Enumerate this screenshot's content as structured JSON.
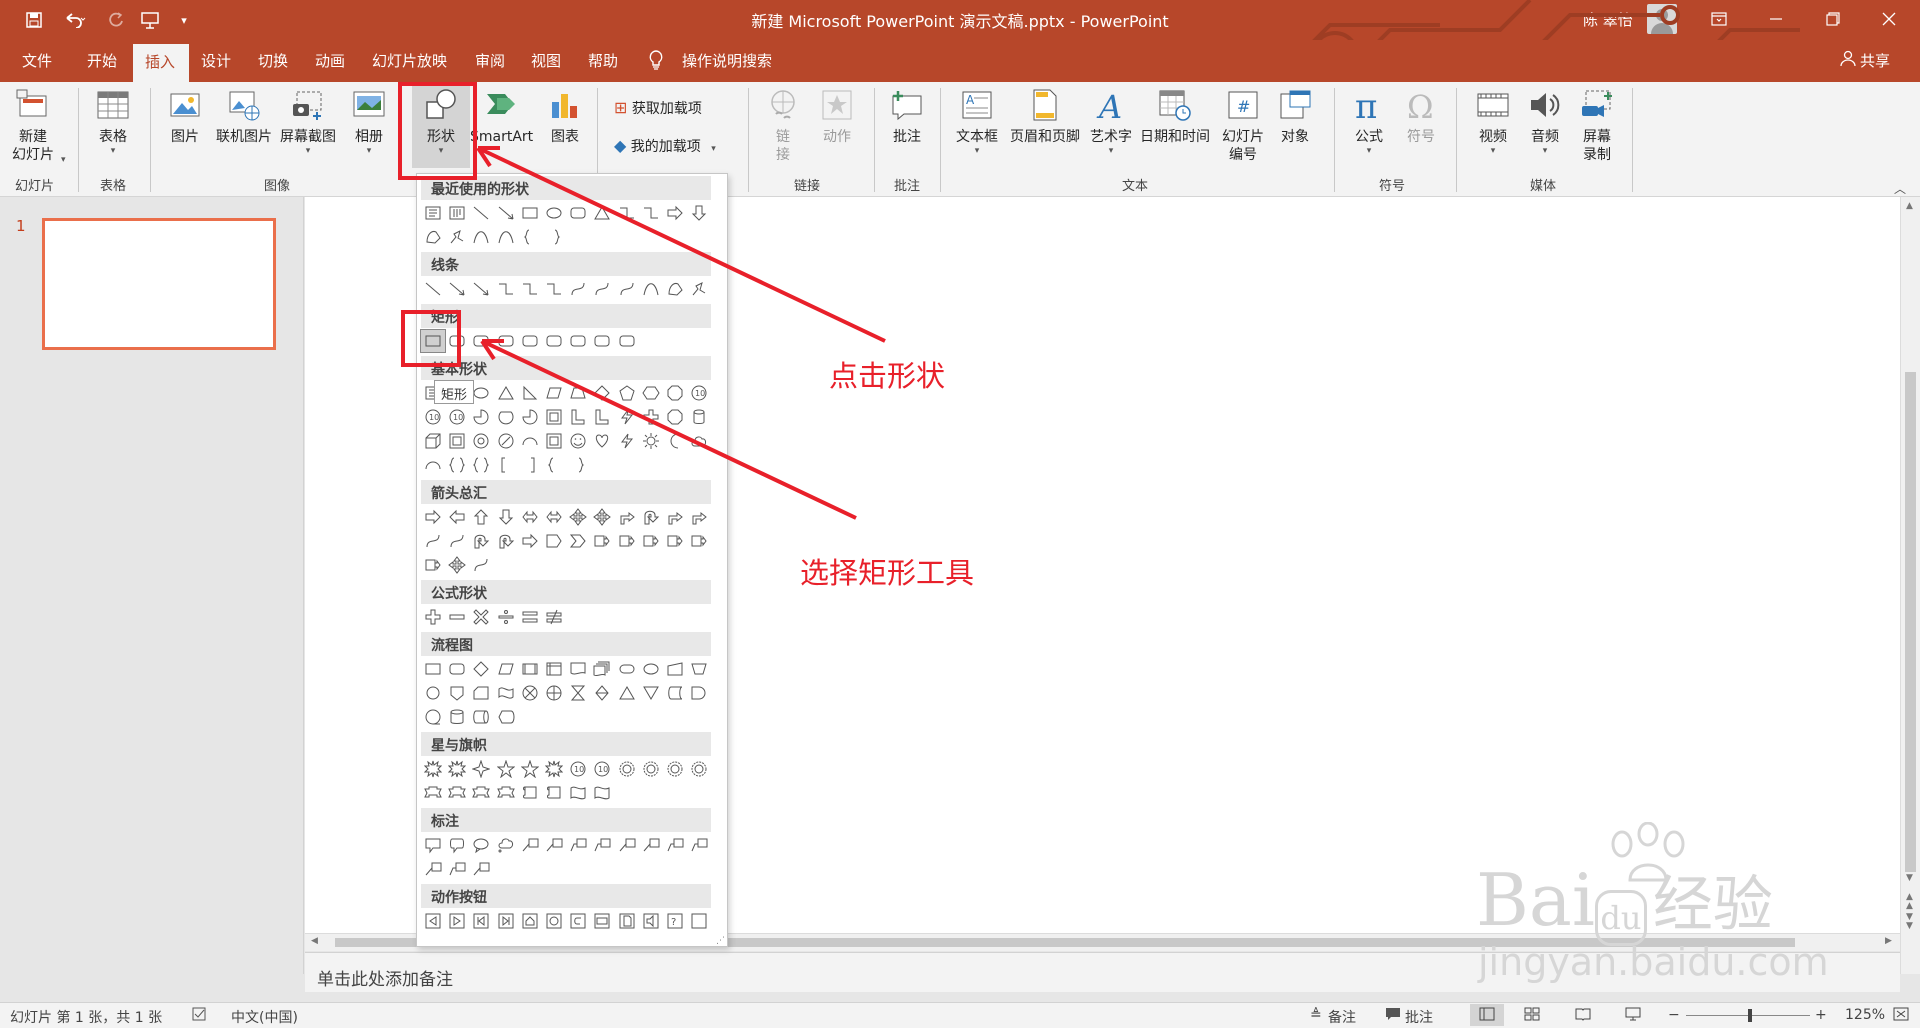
{
  "window": {
    "title": "新建 Microsoft PowerPoint 演示文稿.pptx  -  PowerPoint",
    "user": "陈 翠怡",
    "share": "共享"
  },
  "quick_access": [
    "save-icon",
    "undo-icon",
    "redo-icon",
    "present-icon",
    "customize-icon"
  ],
  "menu": {
    "items": [
      "文件",
      "开始",
      "插入",
      "设计",
      "切换",
      "动画",
      "幻灯片放映",
      "审阅",
      "视图",
      "帮助"
    ],
    "active": "插入",
    "search": "操作说明搜索"
  },
  "ribbon": {
    "buttons": {
      "new_slide": "新建\n幻灯片",
      "table": "表格",
      "picture": "图片",
      "online_picture": "联机图片",
      "screenshot": "屏幕截图",
      "album": "相册",
      "shapes": "形状",
      "smartart": "SmartArt",
      "chart": "图表",
      "get_addins": "获取加载项",
      "my_addins": "我的加载项",
      "link": "链\n接",
      "action": "动作",
      "comment": "批注",
      "textbox": "文本框",
      "header_footer": "页眉和页脚",
      "wordart": "艺术字",
      "datetime": "日期和时间",
      "slide_number": "幻灯片\n编号",
      "object": "对象",
      "equation": "公式",
      "symbol": "符号",
      "video": "视频",
      "audio": "音频",
      "screen_record": "屏幕\n录制"
    },
    "groups": {
      "slides": "幻灯片",
      "tables": "表格",
      "images": "图像",
      "links": "链接",
      "comments": "批注",
      "text": "文本",
      "symbols": "符号",
      "media": "媒体"
    }
  },
  "shapes_gallery": {
    "sections": [
      "最近使用的形状",
      "线条",
      "矩形",
      "基本形状",
      "箭头总汇",
      "公式形状",
      "流程图",
      "星与旗帜",
      "标注",
      "动作按钮"
    ],
    "tooltip": "矩形"
  },
  "slides": {
    "current_number": "1"
  },
  "notes": {
    "placeholder": "单击此处添加备注"
  },
  "status": {
    "slide_info": "幻灯片 第 1 张，共 1 张",
    "language": "中文(中国)",
    "notes_btn": "备注",
    "comments_btn": "批注",
    "zoom": "125%"
  },
  "annotations": {
    "click_shape": "点击形状",
    "select_rect": "选择矩形工具"
  },
  "watermark": {
    "brand": "Bai",
    "brand2": "du",
    "cn": "经验",
    "url": "jingyan.baidu.com"
  },
  "colors": {
    "accent": "#b7472a",
    "annotation": "#e8202a",
    "thumb_border": "#ea6f4b"
  }
}
